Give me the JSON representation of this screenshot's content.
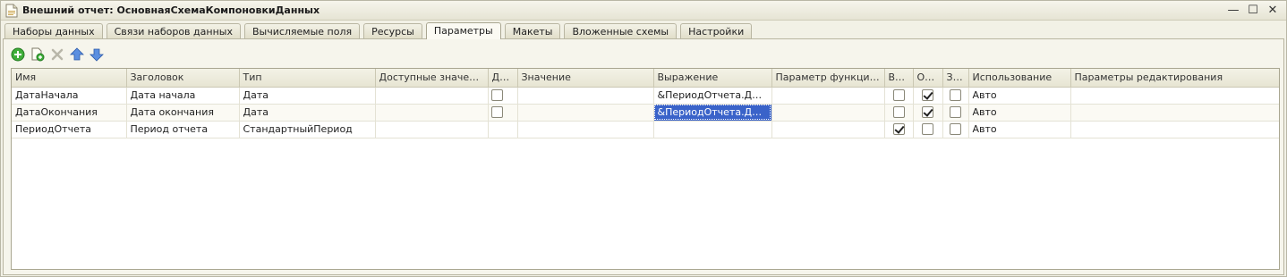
{
  "window": {
    "title": "Внешний отчет: ОсновнаяСхемаКомпоновкиДанных",
    "minimize_glyph": "—",
    "maximize_glyph": "☐",
    "close_glyph": "✕"
  },
  "tabs": [
    {
      "label": "Наборы данных",
      "active": false
    },
    {
      "label": "Связи наборов данных",
      "active": false
    },
    {
      "label": "Вычисляемые поля",
      "active": false
    },
    {
      "label": "Ресурсы",
      "active": false
    },
    {
      "label": "Параметры",
      "active": true
    },
    {
      "label": "Макеты",
      "active": false
    },
    {
      "label": "Вложенные схемы",
      "active": false
    },
    {
      "label": "Настройки",
      "active": false
    }
  ],
  "toolbar": {
    "icons": [
      "add-icon",
      "copy-icon",
      "delete-icon",
      "move-up-icon",
      "move-down-icon"
    ]
  },
  "grid": {
    "columns": [
      "Имя",
      "Заголовок",
      "Тип",
      "Доступные значения",
      "До...",
      "Значение",
      "Выражение",
      "Параметр функциона...",
      "Вк...",
      "Ог...",
      "За...",
      "Использование",
      "Параметры редактирования"
    ],
    "rows": [
      {
        "name": "ДатаНачала",
        "title": "Дата начала",
        "type": "Дата",
        "available_values": "",
        "do_checked": false,
        "value": "",
        "expression": "&ПериодОтчета.Дата...",
        "functional_param": "",
        "vk_checked": false,
        "og_checked": true,
        "za_checked": false,
        "usage": "Авто",
        "edit_params": ""
      },
      {
        "name": "ДатаОкончания",
        "title": "Дата окончания",
        "type": "Дата",
        "available_values": "",
        "do_checked": false,
        "value": "",
        "expression": "&ПериодОтчета.Дата...",
        "functional_param": "",
        "vk_checked": false,
        "og_checked": true,
        "za_checked": false,
        "usage": "Авто",
        "edit_params": ""
      },
      {
        "name": "ПериодОтчета",
        "title": "Период отчета",
        "type": "СтандартныйПериод",
        "available_values": "",
        "do_checked": null,
        "value": "",
        "expression": "",
        "functional_param": "",
        "vk_checked": true,
        "og_checked": false,
        "za_checked": false,
        "usage": "Авто",
        "edit_params": ""
      }
    ],
    "selected_row": 1,
    "highlight_color": "#3a63c9"
  }
}
